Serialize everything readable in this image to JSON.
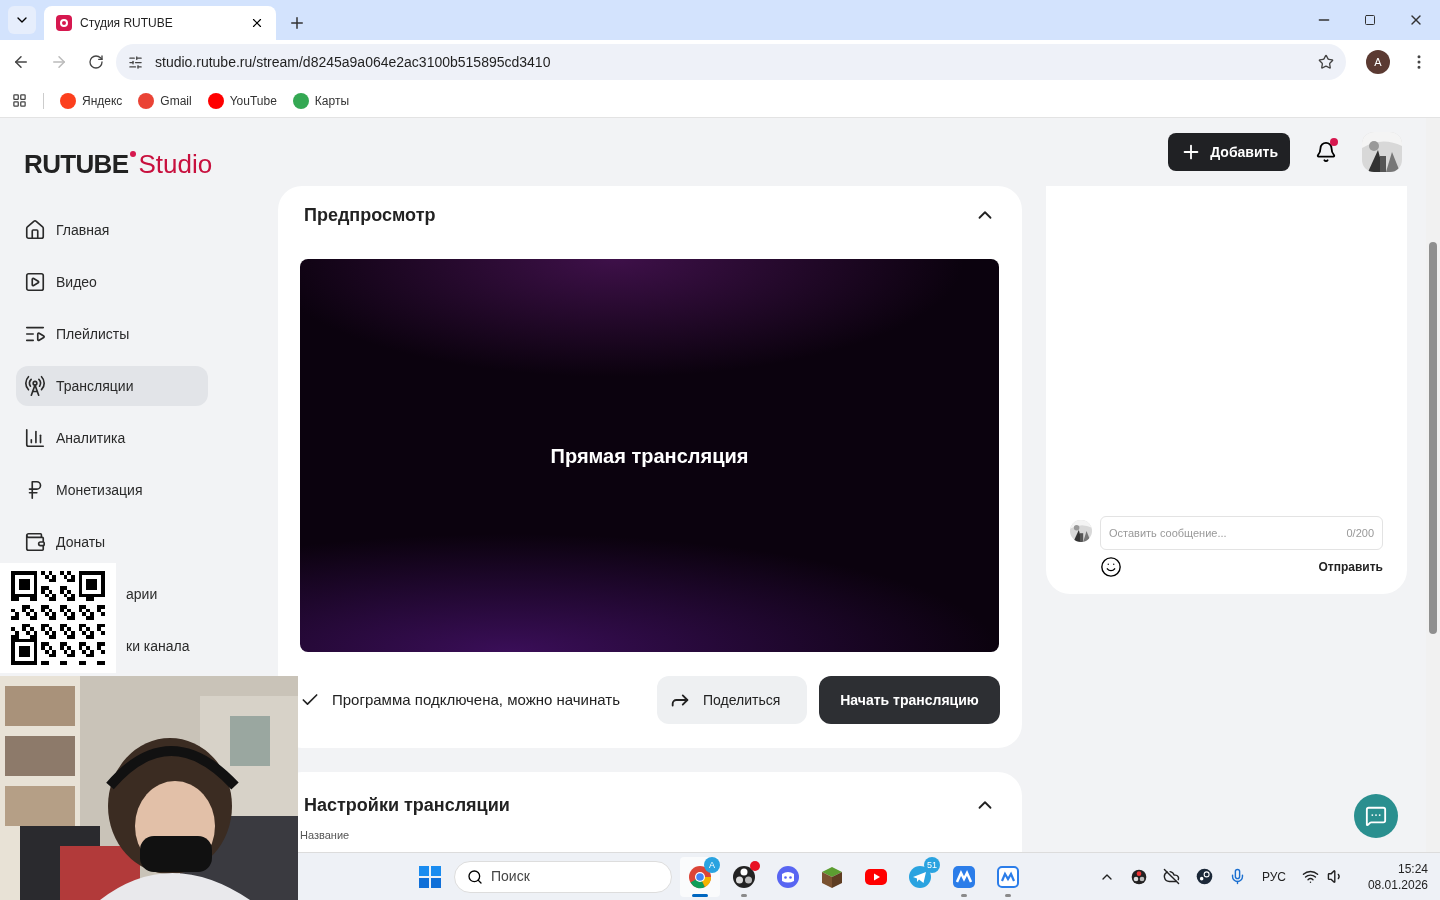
{
  "browser": {
    "tab": {
      "title": "Студия RUTUBE"
    },
    "url": "studio.rutube.ru/stream/d8245a9a064e2ac3100b515895cd3410",
    "profile_initial": "A",
    "bookmarks": [
      {
        "label": "Яндекс",
        "kind": "yandex"
      },
      {
        "label": "Gmail",
        "kind": "gmail"
      },
      {
        "label": "YouTube",
        "kind": "youtube"
      },
      {
        "label": "Карты",
        "kind": "maps"
      }
    ]
  },
  "logo": {
    "brand": "RUTUBE",
    "product": "Studio"
  },
  "header": {
    "add_button": "Добавить",
    "notifications_unread": true
  },
  "sidebar": {
    "items": [
      {
        "label": "Главная",
        "kind": "home",
        "selected": false
      },
      {
        "label": "Видео",
        "kind": "video",
        "selected": false
      },
      {
        "label": "Плейлисты",
        "kind": "playlists",
        "selected": false
      },
      {
        "label": "Трансляции",
        "kind": "streams",
        "selected": true
      },
      {
        "label": "Аналитика",
        "kind": "analytics",
        "selected": false
      },
      {
        "label": "Монетизация",
        "kind": "money",
        "selected": false
      },
      {
        "label": "Донаты",
        "kind": "wallet",
        "selected": false
      },
      {
        "label": "арии",
        "kind": "covered",
        "selected": false
      },
      {
        "label": "ки канала",
        "kind": "covered",
        "selected": false
      }
    ]
  },
  "preview": {
    "title": "Предпросмотр",
    "expanded": true,
    "video_caption": "Прямая трансляция",
    "status": "Программа подключена, можно начинать",
    "share_button": "Поделиться",
    "start_button": "Начать трансляцию"
  },
  "settings": {
    "title": "Настройки трансляции",
    "expanded": true,
    "field_label": "Название"
  },
  "chat": {
    "placeholder": "Оставить сообщение...",
    "counter": "0/200",
    "send_button": "Отправить"
  },
  "taskbar": {
    "search_placeholder": "Поиск",
    "apps": [
      {
        "kind": "chrome",
        "badge": "A",
        "active": true,
        "running": true,
        "notification_dot": false
      },
      {
        "kind": "obs",
        "active": false,
        "running": true,
        "notification_dot": true
      },
      {
        "kind": "discord",
        "active": false,
        "running": false,
        "notification_dot": false
      },
      {
        "kind": "minecraft",
        "active": false,
        "running": false,
        "notification_dot": false
      },
      {
        "kind": "youtube",
        "active": false,
        "running": false,
        "notification_dot": false
      },
      {
        "kind": "telegram",
        "badge": "51",
        "active": false,
        "running": false,
        "notification_dot": false
      },
      {
        "kind": "app",
        "active": false,
        "running": true,
        "notification_dot": false
      },
      {
        "kind": "app-outline",
        "active": false,
        "running": true,
        "notification_dot": false
      }
    ],
    "language": "РУС",
    "time": "15:24",
    "date": "08.01.2026"
  }
}
